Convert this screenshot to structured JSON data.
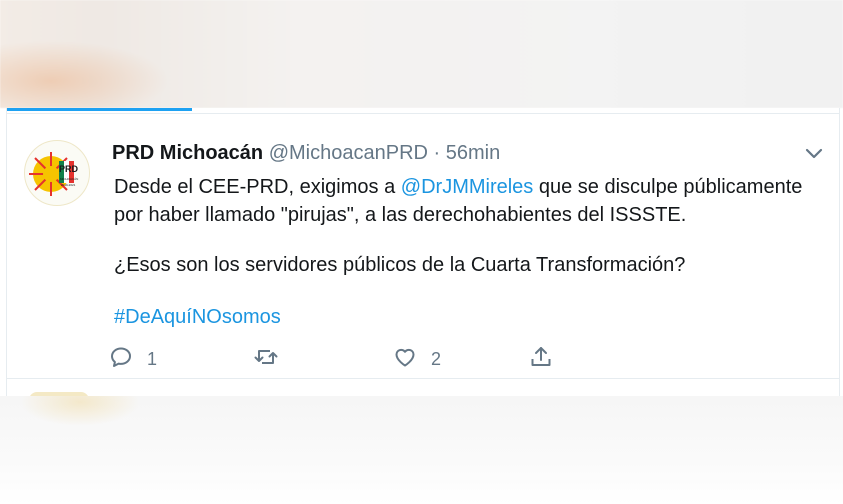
{
  "tweet": {
    "author_name": "PRD Michoacán",
    "handle": "@MichoacanPRD",
    "separator": "·",
    "time": "56min",
    "avatar_logo": {
      "main_text": "PRD",
      "sub_text": "MICHOACÁN",
      "tag_text": "2019-2021",
      "colors": {
        "yellow": "#f6c400",
        "red": "#e5322d",
        "green": "#128049",
        "black": "#1a1a1a"
      }
    },
    "line1_before": "Desde el CEE-PRD, exigimos a ",
    "mention": "@DrJMMireles",
    "line1_after": " que se disculpe públicamente",
    "line2": "por haber llamado \"pirujas\", a las derechohabientes del ISSSTE.",
    "line3": "¿Esos son los servidores públicos de la Cuarta Transformación?",
    "hashtag": "#DeAquíNOsomos",
    "actions": {
      "reply_count": "1",
      "retweet_count": "",
      "like_count": "2"
    }
  },
  "colors": {
    "accent": "#1da1f2",
    "link": "#1b95e0",
    "text": "#14171a",
    "muted": "#657786"
  }
}
